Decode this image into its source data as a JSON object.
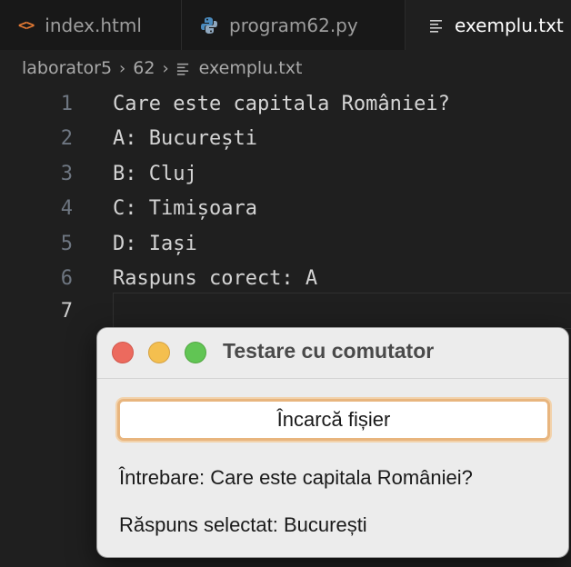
{
  "tabs": [
    {
      "label": "index.html",
      "icon": "code-icon"
    },
    {
      "label": "program62.py",
      "icon": "python-icon"
    },
    {
      "label": "exemplu.txt",
      "icon": "text-file-icon"
    }
  ],
  "breadcrumb": {
    "folder": "laborator5",
    "subfolder": "62",
    "file": "exemplu.txt"
  },
  "editor": {
    "lines": [
      {
        "num": "1",
        "text": "Care este capitala României?"
      },
      {
        "num": "2",
        "text": "A: București"
      },
      {
        "num": "3",
        "text": "B: Cluj"
      },
      {
        "num": "4",
        "text": "C: Timișoara"
      },
      {
        "num": "5",
        "text": "D: Iași"
      },
      {
        "num": "6",
        "text": "Raspuns corect: A"
      },
      {
        "num": "7",
        "text": ""
      }
    ]
  },
  "dialog": {
    "title": "Testare cu comutator",
    "load_button": "Încarcă fișier",
    "question_label": "Întrebare: Care este capitala României?",
    "answer_label": "Răspuns selectat: București"
  },
  "colors": {
    "editor_bg": "#1f1f1f",
    "tab_bg": "#181818",
    "html_icon": "#e37933",
    "python_icon": "#4b8bbe",
    "button_focus": "#e8b57e"
  }
}
